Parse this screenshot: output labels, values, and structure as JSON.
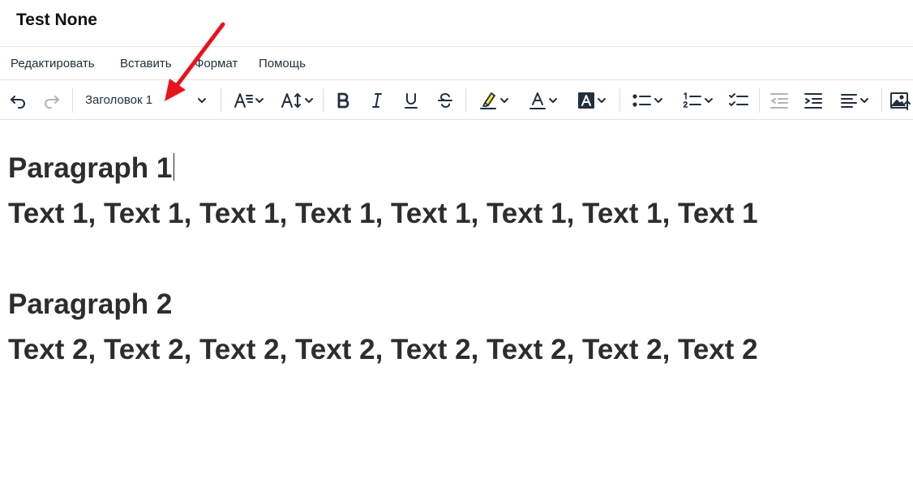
{
  "document": {
    "title": "Test None"
  },
  "menubar": {
    "items": [
      {
        "label": "Редактировать"
      },
      {
        "label": "Вставить"
      },
      {
        "label": "Формат"
      },
      {
        "label": "Помощь"
      }
    ]
  },
  "toolbar": {
    "block_format": {
      "selected": "Заголовок 1"
    },
    "buttons": [
      {
        "icon": "undo-icon"
      },
      {
        "icon": "redo-icon"
      },
      {
        "icon": "font-family-icon"
      },
      {
        "icon": "font-size-icon"
      },
      {
        "icon": "bold-icon"
      },
      {
        "icon": "italic-icon"
      },
      {
        "icon": "underline-icon"
      },
      {
        "icon": "strikethrough-icon"
      },
      {
        "icon": "highlight-color-icon"
      },
      {
        "icon": "text-color-icon"
      },
      {
        "icon": "background-color-icon"
      },
      {
        "icon": "bullet-list-icon"
      },
      {
        "icon": "numbered-list-icon"
      },
      {
        "icon": "checklist-icon"
      },
      {
        "icon": "outdent-icon"
      },
      {
        "icon": "indent-icon"
      },
      {
        "icon": "align-icon"
      },
      {
        "icon": "image-icon"
      }
    ],
    "highlight_color": "#f4e13c",
    "accent_arrow_color": "#e8141c"
  },
  "content": {
    "paragraphs": [
      {
        "heading": "Paragraph 1",
        "text": "Text 1, Text 1, Text 1, Text 1, Text 1, Text 1, Text 1, Text 1"
      },
      {
        "heading": "Paragraph 2",
        "text": "Text 2, Text 2, Text 2, Text 2, Text 2, Text 2, Text 2, Text 2"
      }
    ]
  }
}
